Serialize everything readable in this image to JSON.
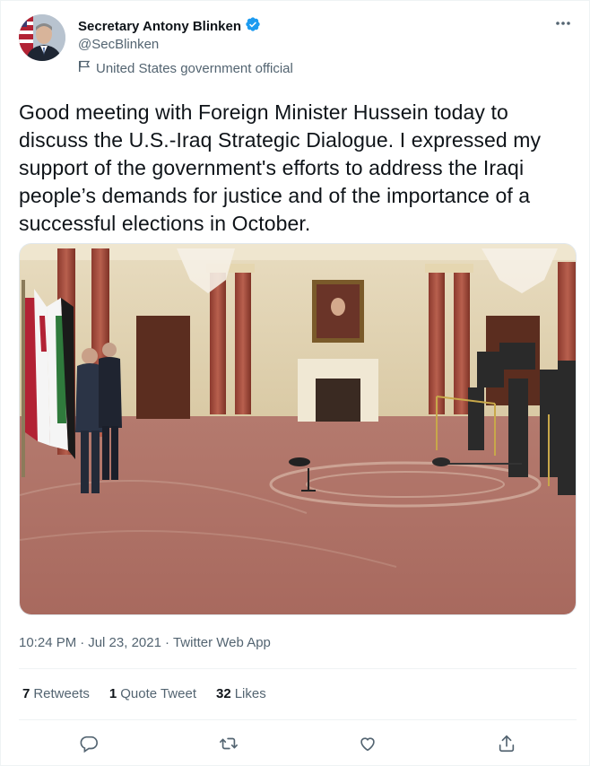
{
  "author": {
    "display_name": "Secretary Antony Blinken",
    "handle": "@SecBlinken",
    "label": "United States government official"
  },
  "tweet": {
    "text": "Good meeting with Foreign Minister Hussein today to discuss the U.S.-Iraq Strategic Dialogue. I expressed my support of the government's efforts to address the Iraqi people’s demands for justice and of the importance of a successful elections in October.",
    "time": "10:24 PM",
    "dot1": "·",
    "date": "Jul 23, 2021",
    "dot2": "·",
    "source": "Twitter Web App"
  },
  "stats": {
    "retweets_count": "7",
    "retweets_label": "Retweets",
    "quotes_count": "1",
    "quotes_label": "Quote Tweet",
    "likes_count": "32",
    "likes_label": "Likes"
  },
  "icons": {
    "more": "more-icon",
    "verified": "verified-badge-icon",
    "label": "government-flag-icon",
    "reply": "reply-icon",
    "retweet": "retweet-icon",
    "like": "heart-icon",
    "share": "share-icon"
  },
  "colors": {
    "verified": "#1d9bf0",
    "secondary_text": "#536471",
    "primary_text": "#0f1419",
    "divider": "#eff3f4"
  }
}
